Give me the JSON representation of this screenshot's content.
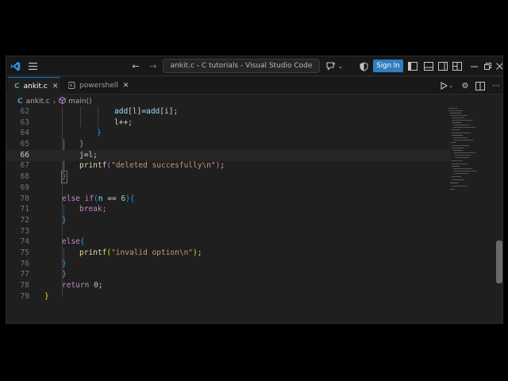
{
  "window": {
    "title": "ankit.c - C tutorials - Visual Studio Code",
    "sign_in_label": "Sign In"
  },
  "icons": {
    "vscode": "vscode-logo",
    "menu": "hamburger",
    "back": "arrow-left",
    "forward": "arrow-right",
    "copilot": "chat-sparkle",
    "shield": "accounts-shield",
    "run": "play-triangle",
    "settings": "gear",
    "split": "split-editor",
    "more": "ellipsis"
  },
  "tabs": [
    {
      "label": "ankit.c",
      "active": true
    },
    {
      "label": "powershell",
      "active": false
    }
  ],
  "breadcrumb": {
    "file": "ankit.c",
    "symbol": "main()"
  },
  "colors": {
    "accent": "#0078d4",
    "signin": "#2f7fbf",
    "editor_bg": "#1f1f1f"
  },
  "code_lines": [
    {
      "n": "62",
      "t": "add[l]=add[i];"
    },
    {
      "n": "63",
      "t": "l++;"
    },
    {
      "n": "64",
      "t": "}"
    },
    {
      "n": "65",
      "t": "}"
    },
    {
      "n": "66",
      "t": "j=l;"
    },
    {
      "n": "67",
      "t": "printf(\"deleted succesfully\\n\");"
    },
    {
      "n": "68",
      "t": "}"
    },
    {
      "n": "69",
      "t": ""
    },
    {
      "n": "70",
      "t": "else if(n == 6){"
    },
    {
      "n": "71",
      "t": "break;"
    },
    {
      "n": "72",
      "t": "}"
    },
    {
      "n": "73",
      "t": ""
    },
    {
      "n": "74",
      "t": "else{"
    },
    {
      "n": "75",
      "t": "printf(\"invalid option\\n\");"
    },
    {
      "n": "76",
      "t": "}"
    },
    {
      "n": "77",
      "t": "}"
    },
    {
      "n": "78",
      "t": "return 0;"
    },
    {
      "n": "79",
      "t": "}"
    }
  ],
  "current_line": "66"
}
